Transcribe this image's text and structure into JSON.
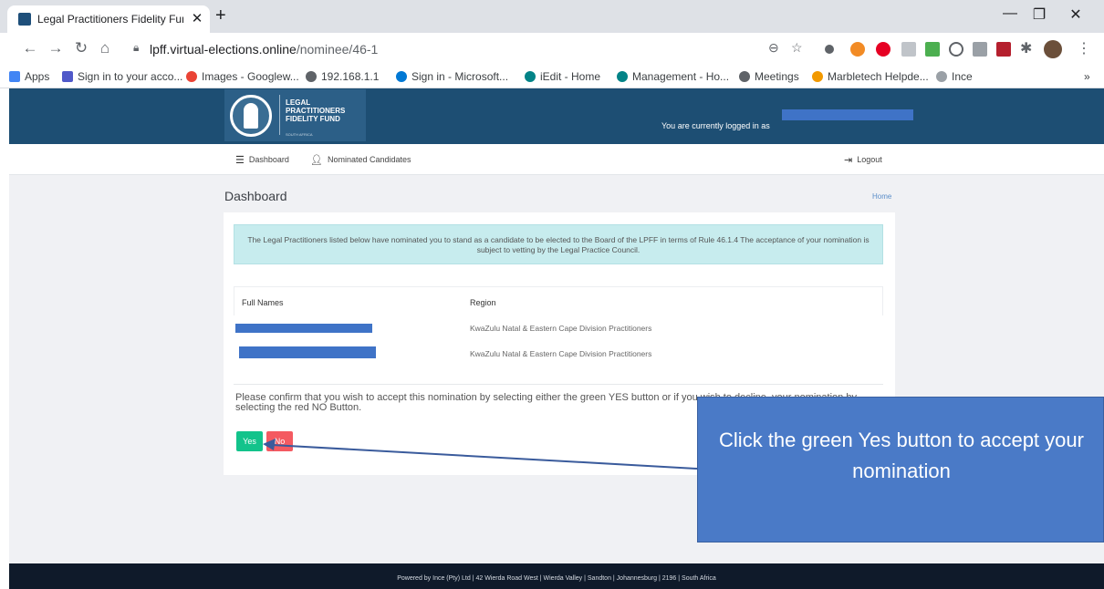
{
  "browser": {
    "tab_title": "Legal Practitioners Fidelity Fund",
    "tab_close": "✕",
    "new_tab": "+",
    "url_host": "lpff.virtual-elections.online",
    "url_path": "/nominee/46-1",
    "window_controls": [
      "—",
      "❐",
      "✕"
    ]
  },
  "bookmarks": [
    {
      "label": "Apps",
      "color": "#4285f4"
    },
    {
      "label": "Sign in to your acco...",
      "color": "#5059c9"
    },
    {
      "label": "Images - Googlew...",
      "color": "#ea4335"
    },
    {
      "label": "192.168.1.1",
      "color": "#5f6368"
    },
    {
      "label": "Sign in - Microsoft...",
      "color": "#0078d4"
    },
    {
      "label": "iEdit - Home",
      "color": "#038387"
    },
    {
      "label": "Management - Ho...",
      "color": "#038387"
    },
    {
      "label": "Meetings",
      "color": "#5f6368"
    },
    {
      "label": "Marbletech Helpde...",
      "color": "#f29900"
    },
    {
      "label": "Ince",
      "color": "#9aa0a6"
    }
  ],
  "bookmarks_overflow": "»",
  "site": {
    "logo_line1": "LEGAL",
    "logo_line2": "PRACTITIONERS",
    "logo_line3": "FIDELITY FUND",
    "logo_sub": "SOUTH AFRICA",
    "logged_in_text": "You are currently logged in as",
    "accent_color": "#1d4e73"
  },
  "nav": {
    "dashboard": "Dashboard",
    "nominated_candidates": "Nominated Candidates",
    "logout": "Logout"
  },
  "page": {
    "title": "Dashboard",
    "breadcrumb_home": "Home",
    "alert_text": "The Legal Practitioners listed below have nominated you to stand as a candidate to be elected to the Board of the LPFF in terms of Rule 46.1.4 The acceptance of your nomination is subject to vetting by the Legal Practice Council.",
    "table": {
      "headers": [
        "Full Names",
        "Region"
      ],
      "rows": [
        {
          "name": "",
          "region": "KwaZulu Natal & Eastern Cape Division Practitioners"
        },
        {
          "name": "",
          "region": "KwaZulu Natal & Eastern Cape Division Practitioners"
        }
      ]
    },
    "confirm_text": "Please confirm that you wish to accept this nomination by selecting either the green YES button or if you wish to decline, your nomination by selecting the red NO Button.",
    "yes_label": "Yes",
    "no_label": "No"
  },
  "callout": {
    "text": "Click the green Yes button to accept your nomination"
  },
  "footer": {
    "text": "Powered by Ince (Pty) Ltd | 42 Wierda Road West | Wierda Valley | Sandton | Johannesburg | 2196 | South Africa"
  }
}
